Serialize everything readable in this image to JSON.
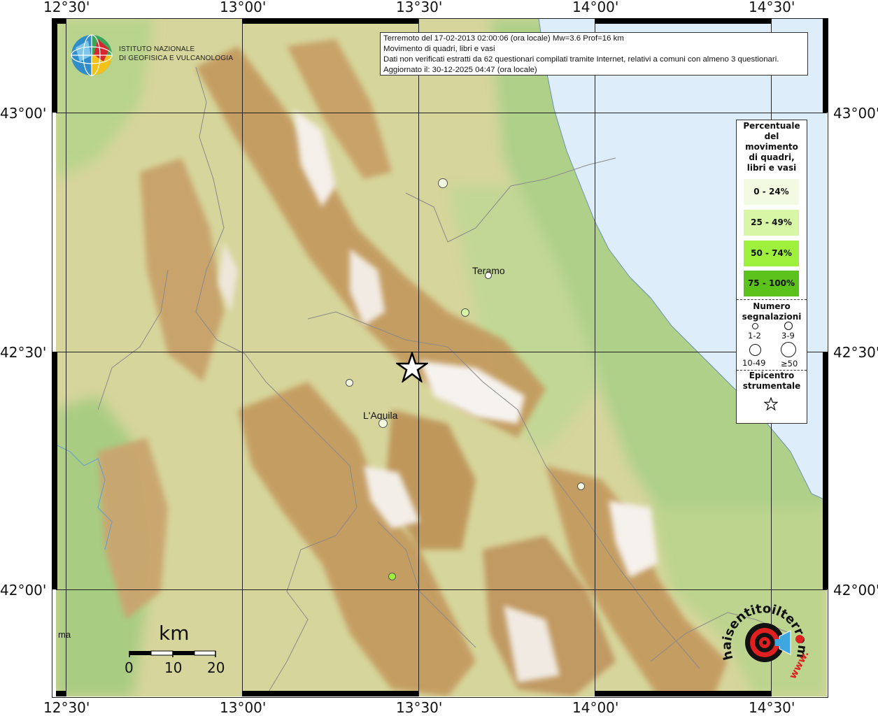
{
  "info": {
    "line1": "Terremoto del 17-02-2013 02:00:06 (ora locale) Mw=3.6 Prof=16 km",
    "line2": "Movimento di quadri, libri e vasi",
    "line3": "Dati non verificati estratti da 62 questionari compilati tramite Internet, relativi a comuni con almeno 3 questionari.",
    "line4": "Aggiornato il: 30-12-2025 04:47 (ora locale)"
  },
  "logo": {
    "line1": "ISTITUTO NAZIONALE",
    "line2": "DI GEOFISICA E VULCANOLOGIA"
  },
  "axes": {
    "lon_top": [
      "12°30'",
      "13°00'",
      "13°30'",
      "14°00'",
      "14°30'"
    ],
    "lon_bottom": [
      "12°30'",
      "13°00'",
      "13°30'",
      "14°00'",
      "14°30'"
    ],
    "lat_left": [
      "43°00'",
      "42°30'",
      "42°00'"
    ],
    "lat_right": [
      "43°00'",
      "42°30'",
      "42°00'"
    ]
  },
  "legend": {
    "title": "Percentuale del movimento di quadri, libri e vasi",
    "title_lines": [
      "Percentuale",
      "del",
      "movimento",
      "di quadri,",
      "libri e vasi"
    ],
    "classes": [
      {
        "label": "0 - 24%",
        "color": "#f2fbe1"
      },
      {
        "label": "25 - 49%",
        "color": "#d8f7a6"
      },
      {
        "label": "50 - 74%",
        "color": "#9ef03c"
      },
      {
        "label": "75 - 100%",
        "color": "#5cc21c"
      }
    ],
    "count_title_lines": [
      "Numero",
      "segnalazioni"
    ],
    "counts": [
      "1-2",
      "3-9",
      "10-49",
      "≥50"
    ],
    "epicenter_title_lines": [
      "Epicentro",
      "strumentale"
    ]
  },
  "places": {
    "teramo": "Teramo",
    "laquila": "L'Aquila",
    "roma_partial": "ma"
  },
  "scale": {
    "unit": "km",
    "ticks": [
      "0",
      "10",
      "20"
    ]
  },
  "watermark": {
    "text": "haisentitoilterremoto.it",
    "url_text": "www."
  },
  "colors": {
    "sea": "#ddeefa",
    "lowland": "#a9cf86",
    "hills": "#d8d69e",
    "mountain": "#c39a5e",
    "peak": "#f4f1ee"
  }
}
